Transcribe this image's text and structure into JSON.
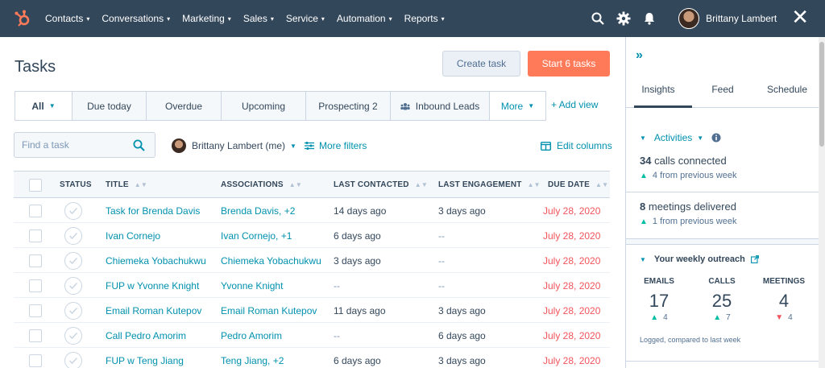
{
  "nav": {
    "items": [
      {
        "label": "Contacts"
      },
      {
        "label": "Conversations"
      },
      {
        "label": "Marketing"
      },
      {
        "label": "Sales"
      },
      {
        "label": "Service"
      },
      {
        "label": "Automation"
      },
      {
        "label": "Reports"
      }
    ],
    "user_name": "Brittany Lambert",
    "close_label": "✕"
  },
  "page": {
    "title": "Tasks",
    "create_button": "Create task",
    "start_button": "Start 6 tasks"
  },
  "tabs": [
    {
      "label": "All"
    },
    {
      "label": "Due today"
    },
    {
      "label": "Overdue"
    },
    {
      "label": "Upcoming"
    },
    {
      "label": "Prospecting 2"
    },
    {
      "label": "Inbound Leads"
    },
    {
      "label": "More"
    }
  ],
  "add_view": "+ Add view",
  "filters": {
    "search_placeholder": "Find a task",
    "owner": "Brittany Lambert (me)",
    "more_filters": "More filters",
    "edit_columns": "Edit columns"
  },
  "table": {
    "headers": {
      "status": "STATUS",
      "title": "TITLE",
      "associations": "ASSOCIATIONS",
      "last_contacted": "LAST CONTACTED",
      "last_engagement": "LAST ENGAGEMENT",
      "due_date": "DUE DATE"
    },
    "rows": [
      {
        "title": "Task for Brenda Davis",
        "assoc": "Brenda Davis, +2",
        "contacted": "14 days ago",
        "engagement": "3 days ago",
        "due": "July 28, 2020"
      },
      {
        "title": "Ivan Cornejo",
        "assoc": "Ivan Cornejo, +1",
        "contacted": "6 days ago",
        "engagement": "--",
        "due": "July 28, 2020"
      },
      {
        "title": "Chiemeka Yobachukwu",
        "assoc": "Chiemeka Yobachukwu",
        "contacted": "3 days ago",
        "engagement": "--",
        "due": "July 28, 2020"
      },
      {
        "title": "FUP w Yvonne Knight",
        "assoc": "Yvonne Knight",
        "contacted": "--",
        "engagement": "--",
        "due": "July 28, 2020"
      },
      {
        "title": "Email Roman Kutepov",
        "assoc": "Email Roman Kutepov",
        "contacted": "11 days ago",
        "engagement": "3 days ago",
        "due": "July 28, 2020"
      },
      {
        "title": "Call Pedro Amorim",
        "assoc": "Pedro Amorim",
        "contacted": "--",
        "engagement": "6 days ago",
        "due": "July 28, 2020"
      },
      {
        "title": "FUP w Teng Jiang",
        "assoc": "Teng Jiang, +2",
        "contacted": "6 days ago",
        "engagement": "3 days ago",
        "due": "July 28, 2020"
      }
    ]
  },
  "panel": {
    "tabs": [
      {
        "label": "Insights"
      },
      {
        "label": "Feed"
      },
      {
        "label": "Schedule"
      }
    ],
    "activities": {
      "title": "Activities",
      "calls_count": "34",
      "calls_label": "calls connected",
      "calls_delta": "4 from previous week",
      "meetings_count": "8",
      "meetings_label": "meetings delivered",
      "meetings_delta": "1 from previous week"
    },
    "outreach": {
      "title": "Your weekly outreach",
      "columns": [
        {
          "label": "EMAILS",
          "value": "17",
          "delta": "4",
          "direction": "up"
        },
        {
          "label": "CALLS",
          "value": "25",
          "delta": "7",
          "direction": "up"
        },
        {
          "label": "MEETINGS",
          "value": "4",
          "delta": "4",
          "direction": "down"
        }
      ],
      "footnote": "Logged, compared to last week"
    }
  },
  "colors": {
    "nav_bg": "#33475b",
    "accent_orange": "#ff7a59",
    "link": "#0091ae",
    "due_red": "#f2545b",
    "teal_up": "#00bda5"
  }
}
